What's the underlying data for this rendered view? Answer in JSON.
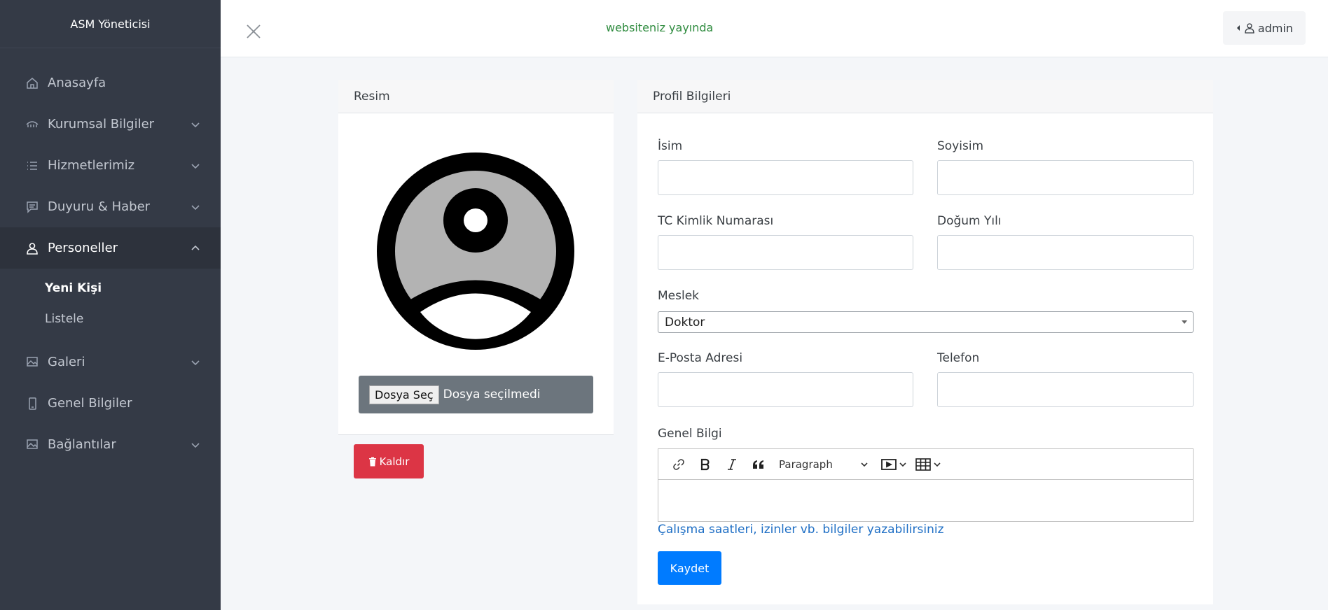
{
  "sidebar": {
    "brand": "ASM Yöneticisi",
    "items": [
      {
        "label": "Anasayfa",
        "icon": "home-icon"
      },
      {
        "label": "Kurumsal Bilgiler",
        "icon": "building-icon"
      },
      {
        "label": "Hizmetlerimiz",
        "icon": "list-icon"
      },
      {
        "label": "Duyuru & Haber",
        "icon": "chat-icon"
      },
      {
        "label": "Personeller",
        "icon": "user-icon"
      },
      {
        "label": "Galeri",
        "icon": "gallery-icon"
      },
      {
        "label": "Genel Bilgiler",
        "icon": "phone-icon"
      },
      {
        "label": "Bağlantılar",
        "icon": "link-gallery-icon"
      }
    ],
    "sub_items": [
      "Yeni Kişi",
      "Listele"
    ]
  },
  "header": {
    "status": "websiteniz yayında",
    "user": "admin"
  },
  "image_card": {
    "title": "Resim",
    "file_button": "Dosya Seç",
    "file_status": "Dosya seçilmedi",
    "remove_label": "Kaldır"
  },
  "profile_card": {
    "title": "Profil Bilgileri",
    "name_label": "İsim",
    "surname_label": "Soyisim",
    "tc_label": "TC Kimlik Numarası",
    "birth_label": "Doğum Yılı",
    "job_label": "Meslek",
    "job_value": "Doktor",
    "email_label": "E-Posta Adresi",
    "phone_label": "Telefon",
    "info_label": "Genel Bilgi",
    "editor_format": "Paragraph",
    "hint": "Çalışma saatleri, izinler vb. bilgiler yazabilirsiniz",
    "save_label": "Kaydet"
  },
  "colors": {
    "sidebar_bg": "#343a46",
    "status_green": "#2e8b3e",
    "danger": "#dc3545",
    "primary": "#007bff"
  }
}
